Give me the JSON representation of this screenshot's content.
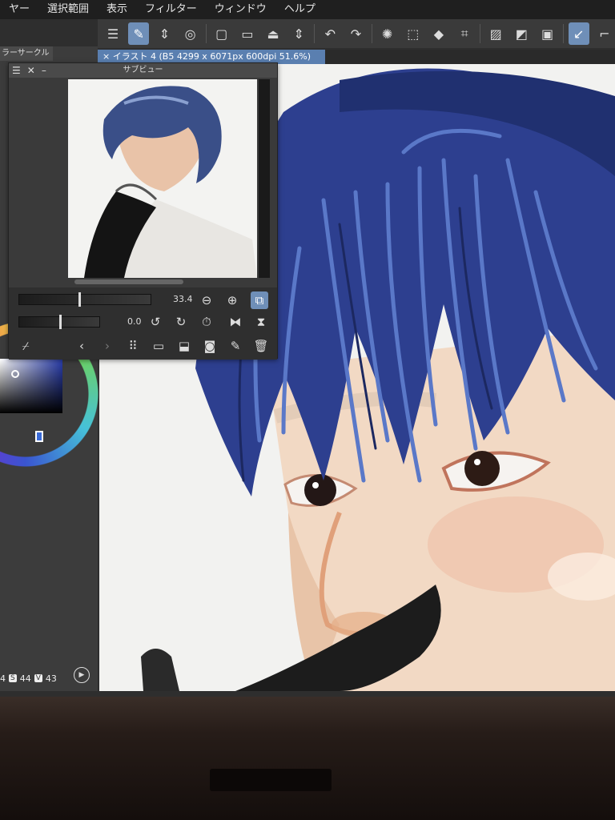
{
  "menu": [
    "ヤー",
    "選択範囲",
    "表示",
    "フィルター",
    "ウィンドウ",
    "ヘルプ"
  ],
  "left_panel": {
    "title": "ラーサークル",
    "color_values": {
      "h": "4",
      "s_label": "S",
      "s": "44",
      "v_label": "V",
      "v": "43"
    }
  },
  "document_tab": "× イラスト 4 (B5 4299 x 6071px 600dpi 51.6%)",
  "subview": {
    "title": "サブビュー",
    "zoom_value": "33.4",
    "rotation_value": "0.0",
    "zoom_level": 0.45,
    "rotation_level": 0.5
  },
  "colors": {
    "accent": "#6f8fb8",
    "doc_tab": "#5a7fb0",
    "hair": "#2d3f8f",
    "skin": "#f2d7c0"
  }
}
